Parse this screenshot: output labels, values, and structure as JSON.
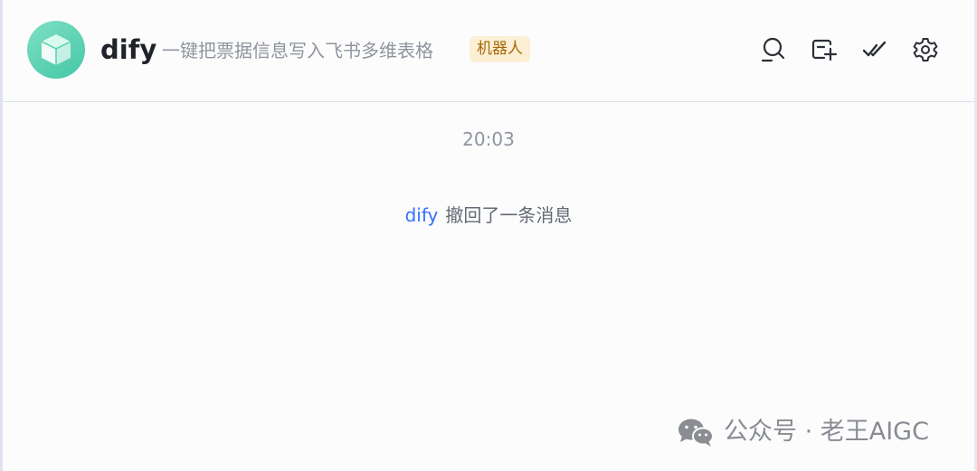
{
  "header": {
    "bot_name": "dify",
    "description": "一键把票据信息写入飞书多维表格",
    "badge": "机器人",
    "avatar_icon": "cube-icon",
    "toolbar": [
      {
        "icon": "search-icon"
      },
      {
        "icon": "add-card-icon"
      },
      {
        "icon": "double-check-icon"
      },
      {
        "icon": "gear-icon"
      }
    ]
  },
  "messages": {
    "time": "20:03",
    "recall_user": "dify",
    "recall_text": "撤回了一条消息"
  },
  "watermark": {
    "icon": "wechat-icon",
    "text": "公众号 · 老王AIGC"
  },
  "colors": {
    "avatar": "#4fcaa9",
    "link": "#3370ff",
    "badge_bg": "#fbefd4",
    "badge_text": "#a7690b"
  }
}
